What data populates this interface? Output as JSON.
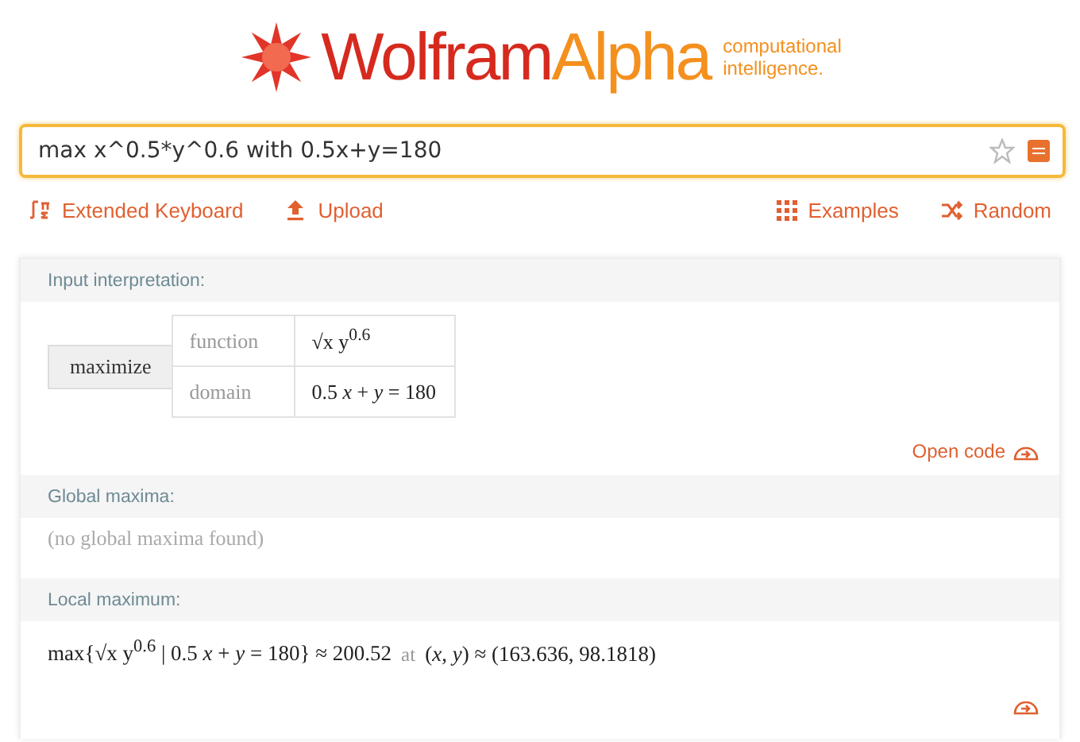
{
  "logo": {
    "word_1": "Wolfram",
    "word_2": "Alpha",
    "tagline_1": "computational",
    "tagline_2": "intelligence."
  },
  "search": {
    "value": "max x^0.5*y^0.6 with 0.5x+y=180"
  },
  "links_left": [
    {
      "label": "Extended Keyboard"
    },
    {
      "label": "Upload"
    }
  ],
  "links_right": [
    {
      "label": "Examples"
    },
    {
      "label": "Random"
    }
  ],
  "pods": [
    {
      "kind": "interpretation",
      "title": "Input interpretation:",
      "button": "maximize",
      "rows": [
        {
          "label": "function",
          "value": "√x  y$^{0.6}$"
        },
        {
          "label": "domain",
          "value": "0.5 *x* + *y* = 180"
        }
      ],
      "link": "Open code"
    },
    {
      "kind": "text",
      "title": "Global maxima:",
      "text": "(no global maxima found)"
    },
    {
      "kind": "result",
      "title": "Local maximum:",
      "formula": "max{√x  y$^{0.6}$ | 0.5 *x* + *y* = 180} ≈ 200.52",
      "connector": "at",
      "point": "(*x*, *y*) ≈ (163.636, 98.1818)"
    }
  ]
}
